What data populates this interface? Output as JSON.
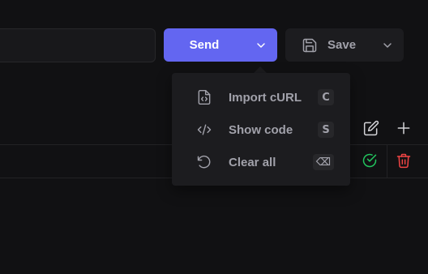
{
  "toolbar": {
    "send_label": "Send",
    "save_label": "Save"
  },
  "menu": {
    "items": [
      {
        "label": "Import cURL",
        "shortcut": "C",
        "icon": "file-code-icon"
      },
      {
        "label": "Show code",
        "shortcut": "S",
        "icon": "code-brackets-icon"
      },
      {
        "label": "Clear all",
        "shortcut": "⌫",
        "icon": "rotate-ccw-icon"
      }
    ]
  },
  "colors": {
    "accent": "#6366f1",
    "success": "#22c55e",
    "danger": "#ef4444",
    "muted_text": "#a1a1aa",
    "panel_bg": "#1c1c1f"
  }
}
